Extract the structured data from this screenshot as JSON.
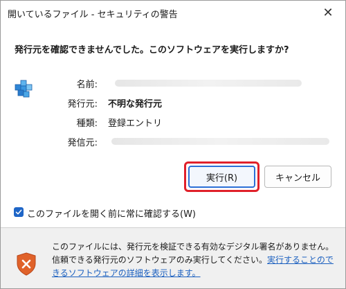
{
  "window": {
    "title": "開いているファイル - セキュリティの警告",
    "close_glyph": "✕"
  },
  "dialog": {
    "headline": "発行元を確認できませんでした。このソフトウェアを実行しますか?",
    "fields": [
      {
        "label": "名前:",
        "value": ""
      },
      {
        "label": "発行元:",
        "value": "不明な発行元"
      },
      {
        "label": "種類:",
        "value": "登録エントリ"
      },
      {
        "label": "発信元:",
        "value": ""
      }
    ],
    "run_button": "実行(R)",
    "cancel_button": "キャンセル",
    "checkbox_label": "このファイルを開く前に常に確認する(W)",
    "checkbox_checked": true
  },
  "footer": {
    "text": "このファイルには、発行元を検証できる有効なデジタル署名がありません。信頼できる発行元のソフトウェアのみ実行してください。",
    "link": "実行することのできるソフトウェアの詳細を表示します。"
  },
  "icons": {
    "app": "registry-file-icon",
    "shield": "warning-shield-icon"
  },
  "colors": {
    "accent": "#2b6fd6",
    "highlight": "#e0202a",
    "shield": "#e0622a",
    "link": "#1a5fbf"
  }
}
